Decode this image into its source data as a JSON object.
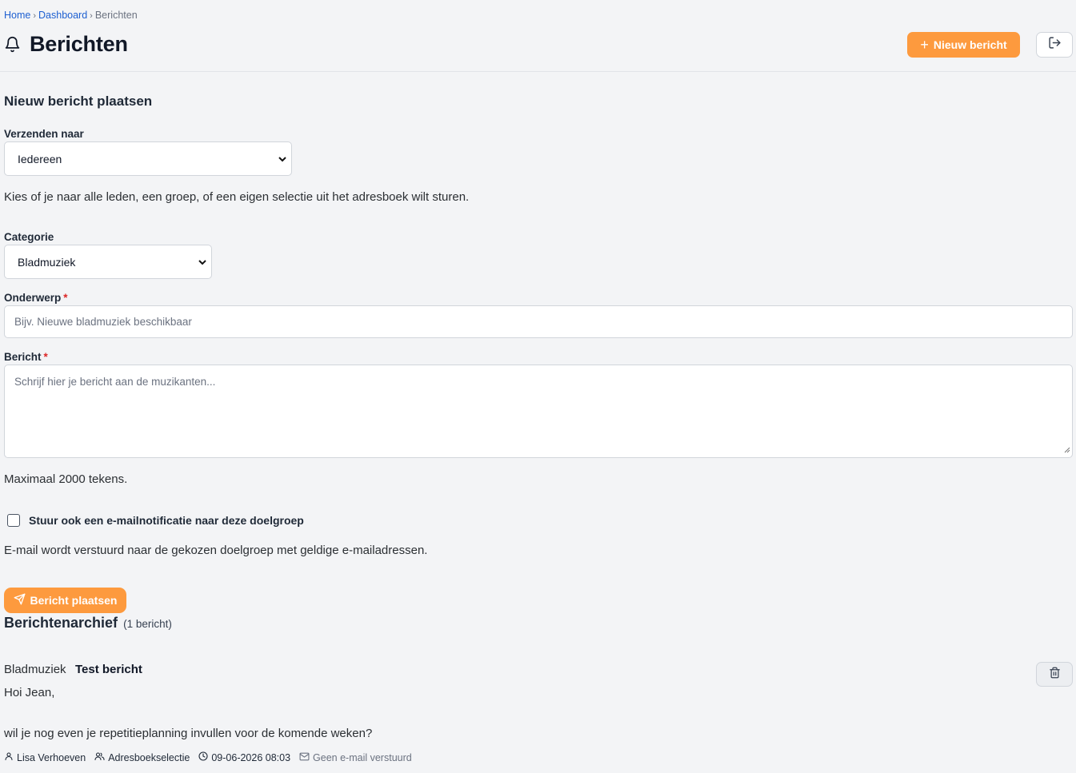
{
  "breadcrumb": {
    "items": [
      "Home",
      "Dashboard"
    ],
    "current": "Berichten"
  },
  "header": {
    "title": "Berichten",
    "new_button_label": "Nieuw bericht"
  },
  "form": {
    "section_title": "Nieuw bericht plaatsen",
    "send_to_label": "Verzenden naar",
    "send_to_value": "Iedereen",
    "send_to_help": "Kies of je naar alle leden, een groep, of een eigen selectie uit het adresboek wilt sturen.",
    "category_label": "Categorie",
    "category_value": "Bladmuziek",
    "subject_label": "Onderwerp",
    "subject_required": "*",
    "subject_placeholder": "Bijv. Nieuwe bladmuziek beschikbaar",
    "message_label": "Bericht",
    "message_required": "*",
    "message_placeholder": "Schrijf hier je bericht aan de muzikanten...",
    "message_help": "Maximaal 2000 tekens.",
    "email_checkbox_label": "Stuur ook een e-mailnotificatie naar deze doelgroep",
    "email_checkbox_checked": false,
    "email_help": "E-mail wordt verstuurd naar de gekozen doelgroep met geldige e-mailadressen.",
    "submit_label": "Bericht plaatsen"
  },
  "archive": {
    "title": "Berichtenarchief",
    "count_label": "(1 bericht)",
    "messages": [
      {
        "category": "Bladmuziek",
        "subject": "Test bericht",
        "body_line_1": "Hoi Jean,",
        "body_line_2": "wil je nog even je repetitieplanning invullen voor de komende weken?",
        "author": "Lisa Verhoeven",
        "audience": "Adresboekselectie",
        "datetime": "09-06-2026 08:03",
        "email_status": "Geen e-mail verstuurd"
      }
    ]
  },
  "colors": {
    "accent": "#fd9a3e",
    "link": "#1d5fd1",
    "required": "#dc2626",
    "background": "#f3f4f6"
  },
  "icons": {
    "title": "bell-icon",
    "new_button": "plus-icon",
    "logout": "logout-icon",
    "submit": "send-icon",
    "delete": "trash-icon",
    "author": "user-icon",
    "audience": "users-icon",
    "datetime": "clock-icon",
    "email": "mail-icon"
  }
}
